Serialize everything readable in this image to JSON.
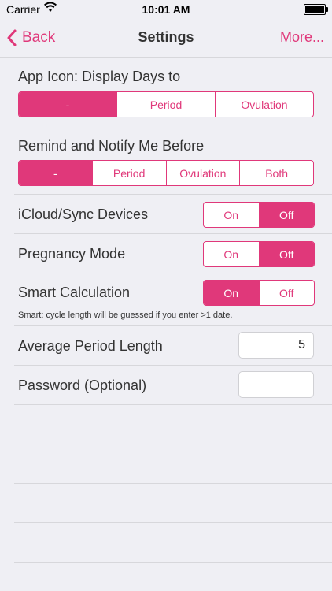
{
  "status": {
    "carrier": "Carrier",
    "time": "10:01 AM"
  },
  "nav": {
    "back": "Back",
    "title": "Settings",
    "more": "More..."
  },
  "app_icon": {
    "label": "App Icon: Display Days to",
    "options": [
      "-",
      "Period",
      "Ovulation"
    ],
    "selected": 0
  },
  "remind": {
    "label": "Remind and Notify Me Before",
    "options": [
      "-",
      "Period",
      "Ovulation",
      "Both"
    ],
    "selected": 0
  },
  "icloud": {
    "label": "iCloud/Sync Devices",
    "options": [
      "On",
      "Off"
    ],
    "selected": 1
  },
  "pregnancy": {
    "label": "Pregnancy Mode",
    "options": [
      "On",
      "Off"
    ],
    "selected": 1
  },
  "smart": {
    "label": "Smart Calculation",
    "options": [
      "On",
      "Off"
    ],
    "selected": 0,
    "hint": "Smart: cycle length will be guessed if you enter >1 date."
  },
  "avg_period": {
    "label": "Average Period Length",
    "value": "5"
  },
  "password": {
    "label": "Password (Optional)",
    "value": ""
  },
  "colors": {
    "accent": "#e0387a",
    "background": "#efeff4"
  }
}
